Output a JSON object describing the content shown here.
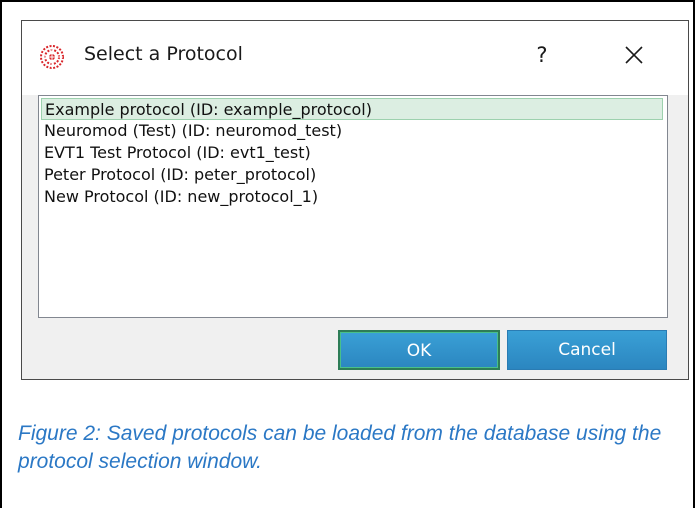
{
  "dialog": {
    "title": "Select a Protocol",
    "help_label": "?",
    "app_icon": "app-logo-icon",
    "close_icon": "close-icon",
    "protocols": [
      {
        "label": "Example protocol (ID: example_protocol)",
        "selected": true
      },
      {
        "label": "Neuromod (Test) (ID: neuromod_test)",
        "selected": false
      },
      {
        "label": "EVT1 Test Protocol (ID: evt1_test)",
        "selected": false
      },
      {
        "label": "Peter Protocol (ID: peter_protocol)",
        "selected": false
      },
      {
        "label": "New Protocol (ID: new_protocol_1)",
        "selected": false
      }
    ],
    "ok_label": "OK",
    "cancel_label": "Cancel"
  },
  "caption": {
    "text": "Figure 2: Saved protocols can be loaded from the database using the protocol selection window."
  },
  "colors": {
    "selection_fill": "#dceee2",
    "button_blue": "#2b86c0",
    "caption_blue": "#2b78c5"
  }
}
